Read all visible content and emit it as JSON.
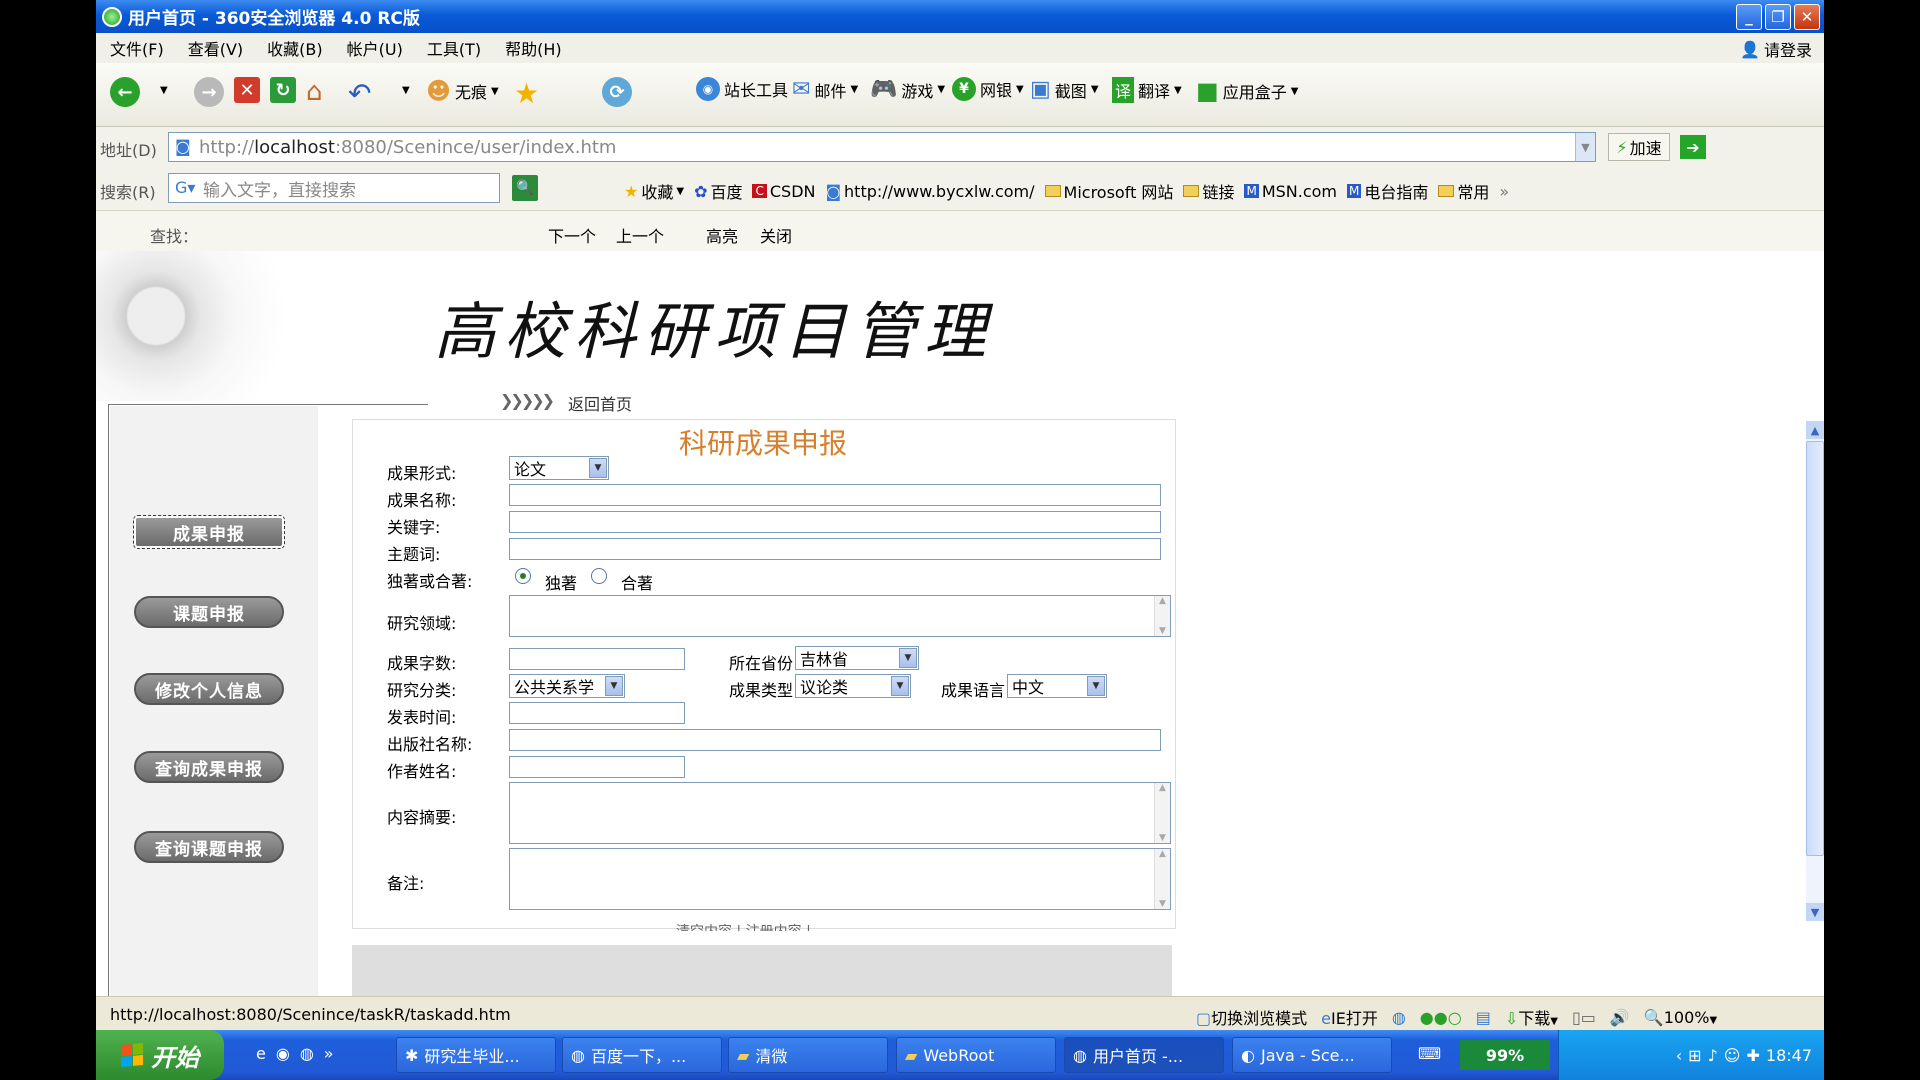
{
  "window": {
    "title": "用户首页 - 360安全浏览器 4.0 RC版"
  },
  "menu": {
    "items": [
      "文件(F)",
      "查看(V)",
      "收藏(B)",
      "帐户(U)",
      "工具(T)",
      "帮助(H)"
    ],
    "login": "请登录"
  },
  "toolbar": {
    "incognito": "无痕",
    "webmaster": "站长工具",
    "mail": "邮件",
    "games": "游戏",
    "banking": "网银",
    "screenshot": "截图",
    "translate": "翻译",
    "appbox": "应用盒子"
  },
  "address": {
    "label": "地址(D)",
    "url_host": "localhost",
    "url_prefix": "http://",
    "url_rest": ":8080/Scenince/user/index.htm",
    "speedup": "加速"
  },
  "search": {
    "label": "搜索(R)",
    "placeholder": "输入文字，直接搜索"
  },
  "favorites": [
    "收藏",
    "百度",
    "CSDN",
    "http://www.bycxlw.com/",
    "Microsoft 网站",
    "链接",
    "MSN.com",
    "电台指南",
    "常用"
  ],
  "findbar": {
    "label": "查找：",
    "next": "下一个",
    "prev": "上一个",
    "highlight": "高亮",
    "close": "关闭"
  },
  "page": {
    "site_title": "高校科研项目管理",
    "back_home": "返回首页",
    "sidebar": [
      "成果申报",
      "课题申报",
      "修改个人信息",
      "查询成果申报",
      "查询课题申报"
    ],
    "form": {
      "title": "科研成果申报",
      "labels": {
        "form_type": "成果形式:",
        "name": "成果名称:",
        "keywords": "关键字:",
        "subject": "主题词:",
        "authorship": "独著或合著:",
        "field": "研究领域:",
        "word_count": "成果字数:",
        "province": "所在省份",
        "category": "研究分类:",
        "result_type": "成果类型",
        "language": "成果语言",
        "pub_time": "发表时间:",
        "publisher": "出版社名称:",
        "author": "作者姓名:",
        "abstract": "内容摘要:",
        "remarks": "备注:"
      },
      "values": {
        "form_type": "论文",
        "province": "吉林省",
        "category": "公共关系学",
        "result_type": "议论类",
        "language": "中文"
      },
      "radio": {
        "sole": "独著",
        "joint": "合著"
      },
      "cut_links": "清空内容 | 注册内容 |"
    }
  },
  "status": {
    "url": "http://localhost:8080/Scenince/taskR/taskadd.htm",
    "switch_mode": "切换浏览模式",
    "ie_open": "IE打开",
    "download": "下载",
    "zoom": "100%"
  },
  "taskbar": {
    "start": "开始",
    "tasks": [
      "研究生毕业...",
      "百度一下，...",
      "清微",
      "WebRoot",
      "用户首页 -...",
      "Java - Sce..."
    ],
    "cpu": "99%",
    "time": "18:47"
  }
}
